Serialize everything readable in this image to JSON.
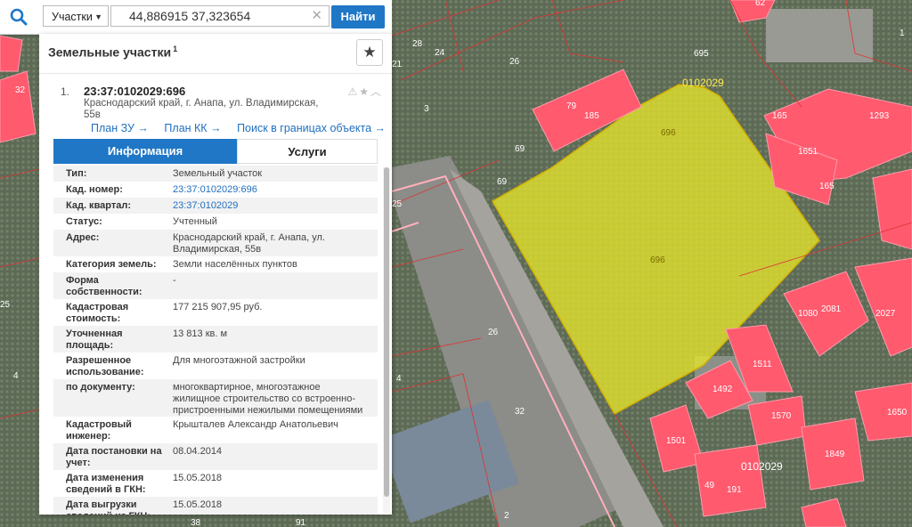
{
  "search": {
    "type_select": "Участки",
    "query": "44,886915 37,323654",
    "find_label": "Найти"
  },
  "panel": {
    "title": "Земельные участки",
    "title_sup": "1",
    "result": {
      "index": "1.",
      "cad_number": "23:37:0102029:696",
      "address": "Краснодарский край, г. Анапа, ул. Владимирская, 55в",
      "links": [
        "План ЗУ →",
        "План КК →",
        "Поиск в границах объекта →"
      ]
    },
    "tabs": [
      "Информация",
      "Услуги"
    ],
    "fields": [
      {
        "label": "Тип:",
        "value": "Земельный участок"
      },
      {
        "label": "Кад. номер:",
        "value": "23:37:0102029:696",
        "link": true
      },
      {
        "label": "Кад. квартал:",
        "value": "23:37:0102029",
        "link": true
      },
      {
        "label": "Статус:",
        "value": "Учтенный"
      },
      {
        "label": "Адрес:",
        "value": "Краснодарский край, г. Анапа, ул. Владимирская, 55в"
      },
      {
        "label": "Категория земель:",
        "value": "Земли населённых пунктов"
      },
      {
        "label": "Форма собственности:",
        "value": "-"
      },
      {
        "label": "Кадастровая стоимость:",
        "value": "177 215 907,95 руб."
      },
      {
        "label": "Уточненная площадь:",
        "value": "13 813 кв. м"
      },
      {
        "label": "Разрешенное использование:",
        "value": "Для многоэтажной застройки"
      },
      {
        "label": "по документу:",
        "value": "многоквартирное, многоэтажное жилищное строительство со встроенно-пристроенными нежилыми помещениями"
      },
      {
        "label": "Кадастровый инженер:",
        "value": "Крышталев Александр Анатольевич"
      },
      {
        "label": "Дата постановки на учет:",
        "value": "08.04.2014"
      },
      {
        "label": "Дата изменения сведений в ГКН:",
        "value": "15.05.2018"
      },
      {
        "label": "Дата выгрузки сведений из ГКН:",
        "value": "15.05.2018"
      }
    ]
  },
  "map": {
    "highlight_color": "#e6e62a",
    "block_label": "0102029",
    "parcel_labels": [
      "696",
      "695",
      "79",
      "185",
      "69",
      "165",
      "1293",
      "1651",
      "1080",
      "2081",
      "2027",
      "1650",
      "1849",
      "1501",
      "1492",
      "1570",
      "1511",
      "49",
      "191",
      "32",
      "26",
      "25",
      "24",
      "21",
      "18",
      "3",
      "4",
      "2",
      "38",
      "91",
      "62",
      "1"
    ]
  }
}
